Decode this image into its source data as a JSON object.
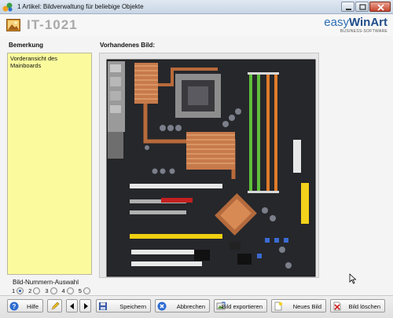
{
  "window": {
    "title": "1  Artikel: Bildverwaltung für beliebige Objekte"
  },
  "header": {
    "article_id": "IT-1021",
    "logo_easy": "easy",
    "logo_winart": "WinArt",
    "logo_subtitle": "BUSINESS-SOFTWARE"
  },
  "remarks": {
    "label": "Bemerkung",
    "text": "Vorderansicht des Mainboards"
  },
  "image_panel": {
    "label": "Vorhandenes Bild:"
  },
  "image_selector": {
    "label": "Bild-Nummern-Auswahl",
    "options": [
      "1",
      "2",
      "3",
      "4",
      "5"
    ],
    "selected": "1"
  },
  "toolbar": {
    "help": "Hilfe",
    "save": "Speichern",
    "cancel": "Abbrechen",
    "export": "Bild exportieren",
    "new_image": "Neues Bild",
    "delete_image": "Bild löschen"
  },
  "colors": {
    "note_background": "#fbfb9e",
    "title_accent": "#1f4d8a",
    "board_pcb": "#2a2a2e",
    "heatpipe_copper": "#c87a4a"
  }
}
